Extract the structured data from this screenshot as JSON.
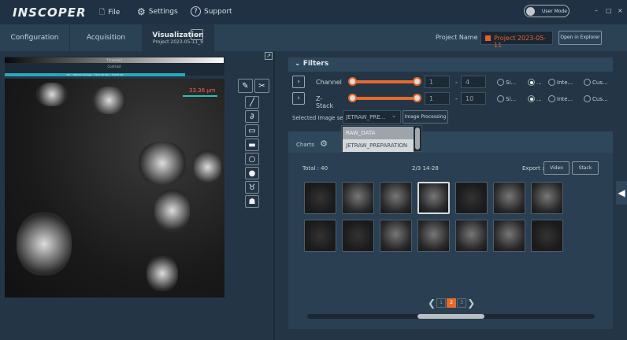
{
  "app": {
    "logo": "INSCOPER",
    "menu": {
      "file": "File",
      "settings": "Settings",
      "support": "Support"
    },
    "user_mode": "User Mode",
    "window": {
      "minimize": "–",
      "maximize": "□",
      "close": "×"
    }
  },
  "tabs": [
    {
      "label": "Configuration"
    },
    {
      "label": "Acquisition"
    },
    {
      "label": "Visualization",
      "subtitle": "Project 2023-05-11_9",
      "active": true
    }
  ],
  "project": {
    "label": "Project Name",
    "value": "Project 2023-05-11",
    "explorer": "Open in Explorer"
  },
  "viewer": {
    "threshold": "Threshold",
    "contrast": "Contrast",
    "stats": "Min : 686.00 Average : 7523.20 Max : 54181.00",
    "scale": "33.36 µm"
  },
  "tools": [
    "pencil",
    "scissors",
    "line",
    "freehand",
    "rectangle",
    "filled-rectangle",
    "ellipse",
    "filled-ellipse",
    "polygon",
    "filled-polygon"
  ],
  "filters": {
    "title": "Filters",
    "rows": [
      {
        "label": "Channel",
        "min": "1",
        "max": "4",
        "options": [
          "Si...",
          "...",
          "Inte...",
          "Cus..."
        ],
        "selected": 1
      },
      {
        "label": "Z-Stack",
        "min": "1",
        "max": "10",
        "options": [
          "Si...",
          "...",
          "Inte...",
          "Cus..."
        ],
        "selected": 1
      }
    ],
    "range_sep": "-"
  },
  "image_set": {
    "label": "Selected Image set",
    "value": "JETRAW_PRE...",
    "options": [
      "RAW_DATA",
      "JETRAW_PREPARATION"
    ],
    "processing": "Image Processing"
  },
  "charts": {
    "label": "Charts"
  },
  "gallery": {
    "total": "Total : 40",
    "page_info": "2/3 14-28",
    "export": "Export :",
    "video": "Video",
    "stack": "Stack",
    "selected_index": 3,
    "pages": [
      "1",
      "2",
      "3"
    ],
    "current_page": "2"
  },
  "colors": {
    "accent": "#e8692e",
    "teal": "#2aa7b8"
  }
}
